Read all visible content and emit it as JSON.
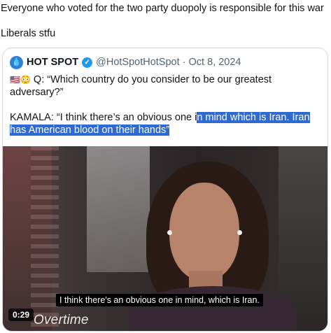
{
  "post": {
    "line1": "Everyone who voted for the two party duopoly is responsible for this war",
    "line2": "Liberals stfu"
  },
  "quoted_post": {
    "avatar_icon": "water-drop-icon",
    "display_name": "HOT SPOT",
    "verified_icon": "verified-badge-icon",
    "handle": "@HotSpotHotSpot",
    "separator": "·",
    "date": "Oct 8, 2024",
    "emoji_flag": "🇺🇸",
    "emoji_face": "😳",
    "text_line1": " Q: “Which country do you consider to be our greatest adversary?”",
    "text_kamala_plain": "KAMALA: “I think there’s an obvious one i",
    "text_kamala_selected": "n mind which is Iran. Iran has American blood on their hands”",
    "selection_color": "#2e6ad1"
  },
  "video": {
    "subtitle": "I think there's an obvious one in mind, which is Iran.",
    "duration": "0:29",
    "logo_text": "Overtime"
  }
}
